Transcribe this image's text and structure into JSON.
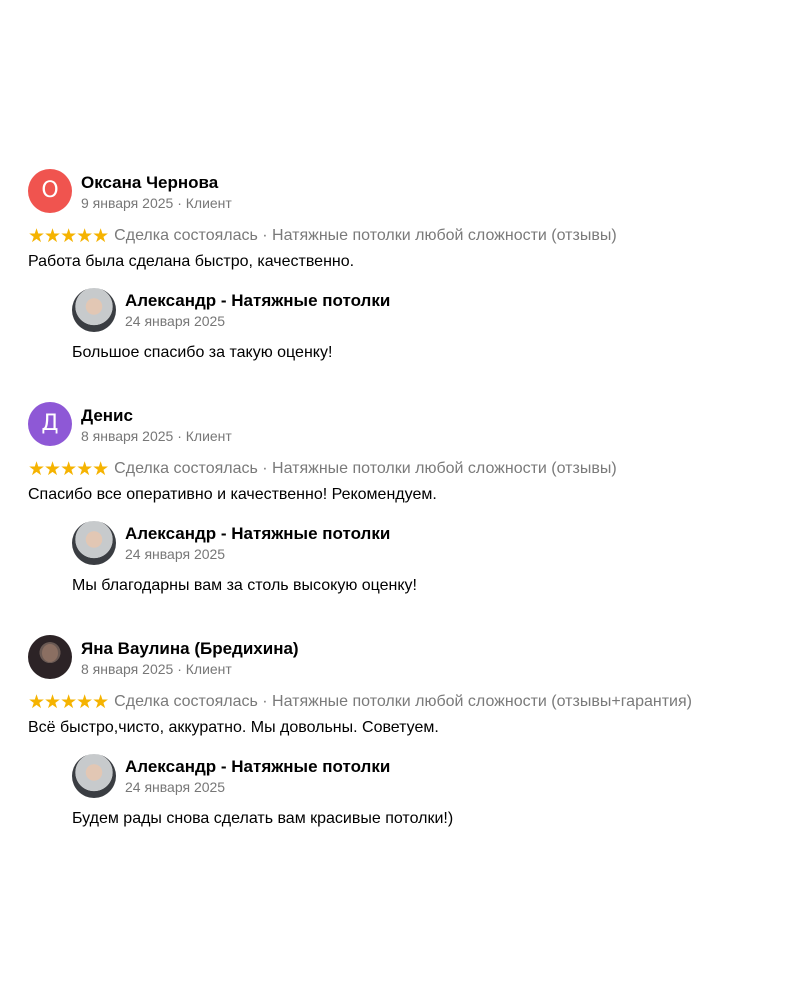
{
  "reviews": [
    {
      "author": "Оксана Чернова",
      "avatar_letter": "О",
      "avatar_color": "#f0544f",
      "meta": "9 января 2025 · Клиент",
      "stars": "★★★★★",
      "deal": "Сделка состоялась · Натяжные потолки любой сложности (отзывы)",
      "text": "Работа была сделана быстро, качественно.",
      "reply": {
        "name": "Александр - Натяжные потолки",
        "date": "24 января 2025",
        "text": "Большое спасибо за такую оценку!"
      }
    },
    {
      "author": "Денис",
      "avatar_letter": "Д",
      "avatar_color": "#8e58d6",
      "meta": "8 января 2025 · Клиент",
      "stars": "★★★★★",
      "deal": "Сделка состоялась · Натяжные потолки любой сложности (отзывы)",
      "text": "Спасибо все оперативно и качественно! Рекомендуем.",
      "reply": {
        "name": "Александр - Натяжные потолки",
        "date": "24 января 2025",
        "text": "Мы благодарны вам за столь высокую оценку!"
      }
    },
    {
      "author": "Яна Ваулина (Бредихина)",
      "avatar_letter": "",
      "avatar_color": "#2c2326",
      "meta": "8 января 2025 · Клиент",
      "stars": "★★★★★",
      "deal": "Сделка состоялась · Натяжные потолки любой сложности (отзывы+гарантия)",
      "text": "Всё быстро,чисто, аккуратно. Мы довольны. Советуем.",
      "reply": {
        "name": "Александр - Натяжные потолки",
        "date": "24 января 2025",
        "text": "Будем рады снова сделать вам красивые потолки!)"
      }
    }
  ]
}
